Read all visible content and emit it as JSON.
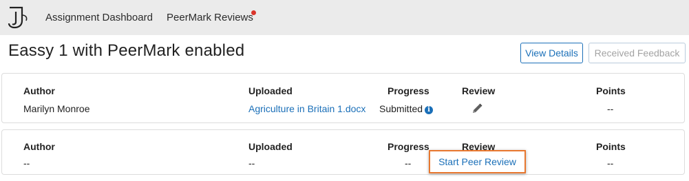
{
  "colors": {
    "accent": "#1a6fb8",
    "notification_dot": "#d9342b",
    "highlight": "#e8772e"
  },
  "nav": {
    "logo_icon": "turnitin-logo-icon",
    "items": [
      {
        "label": "Assignment Dashboard"
      },
      {
        "label": "PeerMark Reviews",
        "has_notification": true
      }
    ]
  },
  "page": {
    "title": "Eassy 1 with PeerMark enabled",
    "view_details_label": "View Details",
    "received_feedback_label": "Received Feedback"
  },
  "columns": {
    "author": "Author",
    "uploaded": "Uploaded",
    "progress": "Progress",
    "review": "Review",
    "points": "Points"
  },
  "submissions": [
    {
      "author": "Marilyn Monroe",
      "uploaded": "Agriculture in Britain 1.docx",
      "progress": "Submitted",
      "progress_icon": "info-icon",
      "review_icon": "pencil-icon",
      "points": "--"
    },
    {
      "author": "--",
      "uploaded": "--",
      "progress": "--",
      "review_action": "Start Peer Review",
      "points": "--"
    }
  ]
}
